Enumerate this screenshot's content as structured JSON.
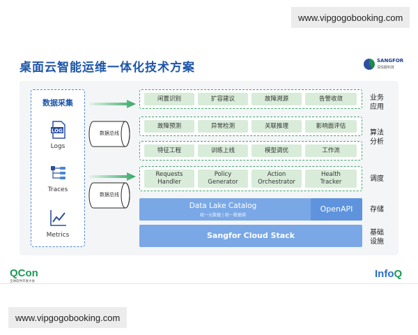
{
  "watermark": "www.vipgogobooking.com",
  "title": "桌面云智能运维一体化技术方案",
  "sangfor_logo": {
    "name": "SANGFOR",
    "sub": "深信服科技"
  },
  "collection": {
    "title": "数据采集",
    "sources": [
      {
        "label": "Logs",
        "icon": "log-file-icon",
        "icon_text": "LOG"
      },
      {
        "label": "Traces",
        "icon": "trace-tree-icon"
      },
      {
        "label": "Metrics",
        "icon": "line-chart-icon"
      }
    ]
  },
  "bus_label": "数据总线",
  "layers": {
    "business": {
      "label": "业务应用",
      "items": [
        "闲置识别",
        "扩容建议",
        "故障溯源",
        "告警收敛"
      ]
    },
    "algorithm": {
      "label": "算法分析",
      "row1": [
        "故障预测",
        "异常检测",
        "关联推理",
        "影响面评估"
      ],
      "row2": [
        "特征工程",
        "训练上线",
        "模型调优",
        "工作流"
      ]
    },
    "schedule": {
      "label": "调度",
      "items": [
        {
          "line1": "Requests",
          "line2": "Handler"
        },
        {
          "line1": "Policy",
          "line2": "Generator"
        },
        {
          "line1": "Action",
          "line2": "Orchestrator"
        },
        {
          "line1": "Health",
          "line2": "Tracker"
        }
      ]
    },
    "storage": {
      "label": "存储",
      "title": "Data Lake Catalog",
      "sub": "统一元数据 | 统一数据湖",
      "openapi": "OpenAPI"
    },
    "infra": {
      "label": "基础设施",
      "title": "Sangfor Cloud Stack"
    }
  },
  "footer": {
    "left": "QCon",
    "left_sub": "全球软件开发大会",
    "right": "InfoQ"
  },
  "colors": {
    "title": "#1d55a8",
    "green_cell": "#d8ecd9",
    "blue_bar": "#7aa8e6",
    "green_border": "#3aa66a"
  }
}
